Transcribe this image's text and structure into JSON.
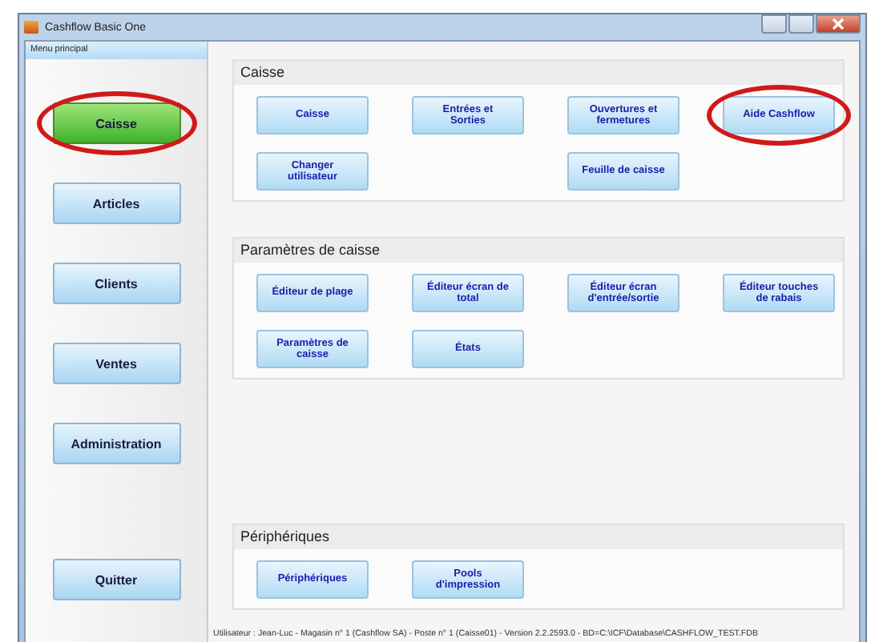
{
  "window": {
    "title": "Cashflow Basic One"
  },
  "sidebar": {
    "header": "Menu principal",
    "items": [
      {
        "label": "Caisse",
        "selected": true,
        "circled": true
      },
      {
        "label": "Articles",
        "selected": false,
        "circled": false
      },
      {
        "label": "Clients",
        "selected": false,
        "circled": false
      },
      {
        "label": "Ventes",
        "selected": false,
        "circled": false
      },
      {
        "label": "Administration",
        "selected": false,
        "circled": false
      }
    ],
    "quit_button": "Quitter"
  },
  "sections": [
    {
      "title": "Caisse",
      "buttons": [
        {
          "label": "Caisse",
          "circled": false
        },
        {
          "label": "Entrées et Sorties",
          "circled": false
        },
        {
          "label": "Ouvertures et fermetures",
          "circled": false
        },
        {
          "label": "Aide Cashflow",
          "circled": true
        },
        {
          "label": "Changer utilisateur",
          "circled": false
        },
        {
          "kind": "gap"
        },
        {
          "label": "Feuille de caisse",
          "circled": false
        }
      ]
    },
    {
      "title": "Paramètres de caisse",
      "buttons": [
        {
          "label": "Éditeur de plage",
          "circled": false
        },
        {
          "label": "Éditeur écran de total",
          "circled": false
        },
        {
          "label": "Éditeur écran d'entrée/sortie",
          "circled": false
        },
        {
          "label": "Éditeur touches de rabais",
          "circled": false
        },
        {
          "label": "Paramètres de caisse",
          "circled": false
        },
        {
          "label": "États",
          "circled": false
        }
      ]
    },
    {
      "title": "Périphériques",
      "buttons": [
        {
          "label": "Périphériques",
          "circled": false
        },
        {
          "label": "Pools d'impression",
          "circled": false
        }
      ]
    }
  ],
  "status_bar": "Utilisateur : Jean-Luc - Magasin n° 1 (Cashflow SA) - Poste n° 1 (Caisse01) - Version 2.2.2593.0 - BD=C:\\ICF\\Database\\CASHFLOW_TEST.FDB"
}
